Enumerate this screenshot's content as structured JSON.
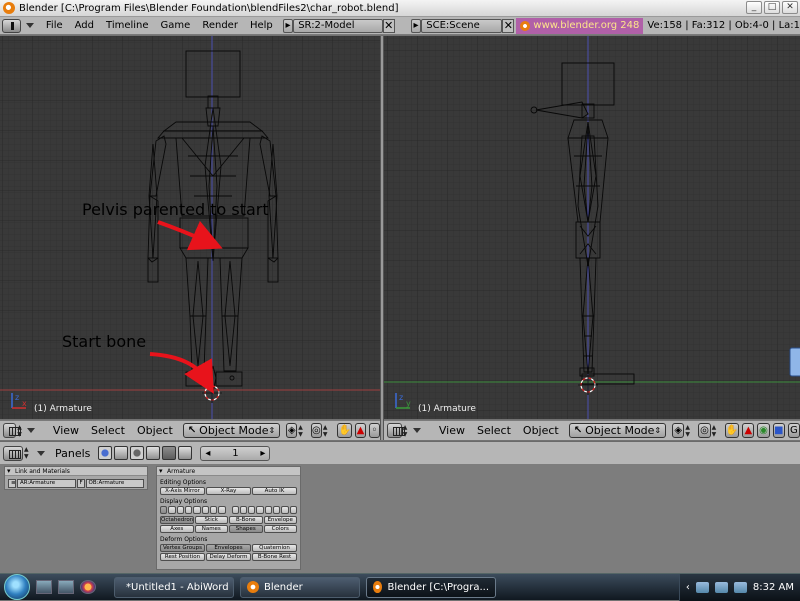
{
  "window": {
    "title": "Blender [C:\\Program Files\\Blender Foundation\\blendFiles2\\char_robot.blend]",
    "buttons": [
      "_",
      "□",
      "✕"
    ]
  },
  "info_header": {
    "menus": [
      "File",
      "Add",
      "Timeline",
      "Game",
      "Render",
      "Help"
    ],
    "screen_field": "SR:2-Model",
    "scene_field": "SCE:Scene",
    "website": "www.blender.org 248",
    "stats": "Ve:158 | Fa:312 | Ob:4-0 | La:1"
  },
  "viewport_left": {
    "label": "(1) Armature",
    "annotations": {
      "pelvis": "Pelvis parented to start",
      "start": "Start bone"
    }
  },
  "viewport_right": {
    "label": "(1) Armature"
  },
  "viewport_header": {
    "menus": [
      "View",
      "Select",
      "Object"
    ],
    "mode": "Object Mode",
    "mode_icon": "armature-icon"
  },
  "buttons_header": {
    "label": "Panels",
    "frame": "1"
  },
  "link_panel": {
    "title": "Link and Materials",
    "ar_field": "AR:Armature",
    "f_label": "F",
    "ob_field": "OB:Armature"
  },
  "armature_panel": {
    "title": "Armature",
    "editing_label": "Editing Options",
    "editing_buttons": [
      "X-Axis Mirror",
      "X-Ray",
      "Auto IK"
    ],
    "display_label": "Display Options",
    "display_row1": [
      "Octahedron",
      "Stick",
      "B-Bone",
      "Envelope"
    ],
    "display_row2": [
      "Axes",
      "Names",
      "Shapes",
      "Colors"
    ],
    "deform_label": "Deform Options",
    "deform_row1": [
      "Vertex Groups",
      "Envelopes",
      "Quaternion"
    ],
    "deform_row2": [
      "Rest Position",
      "Delay Deform",
      "B-Bone Rest"
    ]
  },
  "taskbar": {
    "tasks": [
      "*Untitled1 - AbiWord",
      "Blender",
      "Blender [C:\\Progra..."
    ],
    "clock": "8:32 AM"
  },
  "colors": {
    "viewport_bg": "#393939",
    "header_bg": "#b6b6b6",
    "annotation_arrow": "#e8131b"
  }
}
